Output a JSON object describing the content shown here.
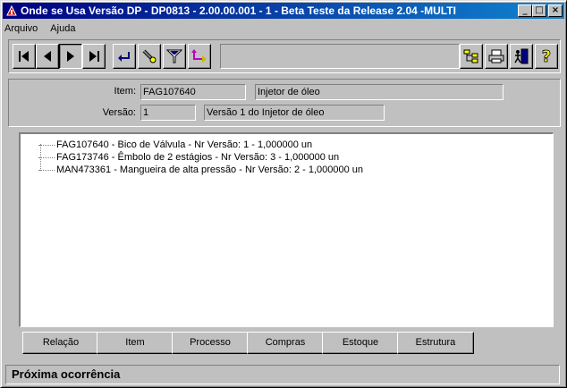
{
  "window": {
    "title": "Onde se Usa Versão DP - DP0813 - 2.00.00.001 - 1 - Beta Teste da Release 2.04 -MULTI",
    "minimize": "_",
    "maximize": "□",
    "close": "×"
  },
  "menu": [
    "Arquivo",
    "Ajuda"
  ],
  "toolbar": {
    "left_icons": [
      "first-record-icon",
      "previous-record-icon",
      "next-record-icon",
      "last-record-icon",
      "return-icon",
      "search-flashlight-icon",
      "filter-icon",
      "export-arrow-icon"
    ],
    "right_icons": [
      "tree-structure-icon",
      "print-icon",
      "exit-door-icon",
      "help-icon"
    ]
  },
  "form": {
    "item_label": "Item:",
    "item_code": "FAG107640",
    "item_desc": "Injetor de óleo",
    "version_label": "Versão:",
    "version_number": "1",
    "version_desc": "Versão 1 do Injetor de óleo"
  },
  "tree": [
    "FAG107640 - Bico de Válvula - Nr Versão: 1 - 1,000000 un",
    "FAG173746 - Êmbolo de 2 estágios - Nr Versão: 3 - 1,000000 un",
    "MAN473361 - Mangueira de alta pressão - Nr Versão: 2 - 1,000000 un"
  ],
  "buttons": [
    "Relação",
    "Item",
    "Processo",
    "Compras",
    "Estoque",
    "Estrutura"
  ],
  "status": "Próxima ocorrência"
}
